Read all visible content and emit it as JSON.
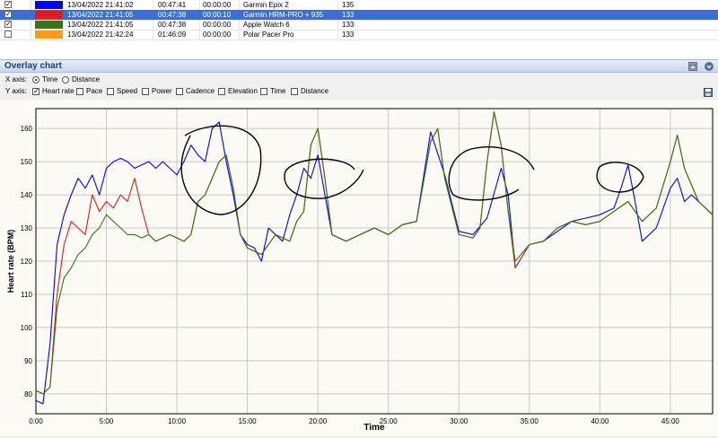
{
  "devices": [
    {
      "checked": true,
      "color": "#0000ff",
      "start": "13/04/2022 21:41:02",
      "duration": "00:47:41",
      "offset": "00:00:00",
      "name": "Garmin Epix 2",
      "value": "135",
      "selected": false
    },
    {
      "checked": true,
      "color": "#d81e1e",
      "start": "13/04/2022 21:41:05",
      "duration": "00:47:38",
      "offset": "00:00:10",
      "name": "Garmin HRM-PRO + 935",
      "value": "133",
      "selected": true
    },
    {
      "checked": true,
      "color": "#2f7b10",
      "start": "13/04/2022 21:41:05",
      "duration": "00:47:38",
      "offset": "00:00:00",
      "name": "Apple Watch 6",
      "value": "133",
      "selected": false
    },
    {
      "checked": false,
      "color": "#ff9a1a",
      "start": "13/04/2022 21:42:24",
      "duration": "01:46:09",
      "offset": "00:00:00",
      "name": "Polar Pacer Pro",
      "value": "133",
      "selected": false
    }
  ],
  "panel": {
    "title": "Overlay chart",
    "x_axis_label": "X axis:",
    "x_options": [
      {
        "label": "Time",
        "selected": true
      },
      {
        "label": "Distance",
        "selected": false
      }
    ],
    "y_axis_label": "Y axis:",
    "y_options": [
      {
        "label": "Heart rate",
        "checked": true
      },
      {
        "label": "Pace",
        "checked": false
      },
      {
        "label": "Speed",
        "checked": false
      },
      {
        "label": "Power",
        "checked": false
      },
      {
        "label": "Cadence",
        "checked": false
      },
      {
        "label": "Elevation",
        "checked": false
      },
      {
        "label": "Time",
        "checked": false
      },
      {
        "label": "Distance",
        "checked": false
      }
    ],
    "icons": [
      "minimize-icon",
      "chevron-down-icon",
      "save-icon"
    ]
  },
  "chart_data": {
    "type": "line",
    "xlabel": "Time",
    "ylabel": "Heart rate (BPM)",
    "x_ticks": [
      "0:00",
      "5:00",
      "10:00",
      "15:00",
      "20:00",
      "25:00",
      "30:00",
      "35:00",
      "40:00",
      "45:00"
    ],
    "y_ticks": [
      80,
      90,
      100,
      110,
      120,
      130,
      140,
      150,
      160
    ],
    "xlim": [
      0,
      48
    ],
    "ylim": [
      74,
      166
    ],
    "grid": true,
    "annotation": "hand-drawn black circles around blue-line peaks",
    "series": [
      {
        "color": "#0000ff",
        "x": [
          0,
          0.5,
          1,
          1.5,
          2,
          2.5,
          3,
          3.5,
          4,
          4.5,
          5,
          5.5,
          6,
          6.5,
          7,
          7.5,
          8,
          8.5,
          9,
          9.5,
          10,
          10.5,
          11,
          11.5,
          12,
          12.5,
          13,
          13.5,
          14,
          14.5,
          15,
          15.5,
          16,
          16.5,
          17,
          17.5,
          18,
          18.5,
          19,
          19.5,
          20,
          20.5,
          21,
          22,
          23,
          24,
          25,
          26,
          27,
          28,
          29,
          30,
          31,
          32,
          33,
          33.5,
          34,
          35,
          36,
          37,
          38,
          39,
          40,
          41,
          41.5,
          42,
          42.5,
          43,
          44,
          45,
          45.5,
          46,
          46.5,
          47,
          48
        ],
        "y": [
          78,
          77,
          95,
          125,
          134,
          140,
          145,
          142,
          146,
          140,
          148,
          150,
          151,
          150,
          148,
          149,
          150,
          148,
          150,
          148,
          146,
          150,
          155,
          152,
          150,
          160,
          162,
          150,
          140,
          128,
          125,
          124,
          120,
          130,
          128,
          126,
          134,
          140,
          148,
          145,
          152,
          140,
          128,
          126,
          128,
          130,
          128,
          131,
          132,
          159,
          146,
          129,
          128,
          133,
          148,
          140,
          118,
          125,
          126,
          129,
          132,
          133,
          134,
          136,
          142,
          149,
          138,
          126,
          130,
          142,
          145,
          138,
          140,
          138,
          134
        ]
      },
      {
        "color": "#d81e1e",
        "x": [
          0,
          0.5,
          1,
          1.5,
          2,
          2.5,
          3,
          3.5,
          4,
          4.5,
          5,
          5.5,
          6,
          6.5,
          7,
          7.5,
          8,
          8.5,
          9,
          9.5,
          10,
          10.5,
          11,
          11.5,
          12,
          12.5,
          13,
          13.5,
          14,
          14.5,
          15,
          16,
          17,
          18,
          18.5,
          19,
          19.5,
          20,
          20.5,
          21,
          22,
          23,
          24,
          25,
          26,
          27,
          28,
          28.5,
          29,
          30,
          31,
          31.5,
          32,
          32.5,
          33,
          33.5,
          34,
          35,
          36,
          37,
          38,
          39,
          40,
          41,
          42,
          43,
          44,
          45,
          45.5,
          46,
          47,
          48
        ],
        "y": [
          81,
          80,
          82,
          110,
          125,
          132,
          130,
          128,
          140,
          135,
          138,
          136,
          140,
          138,
          145,
          136,
          128,
          126,
          127,
          128,
          127,
          126,
          128,
          138,
          140,
          145,
          150,
          152,
          142,
          128,
          124,
          122,
          128,
          126,
          132,
          135,
          155,
          160,
          145,
          128,
          126,
          128,
          130,
          128,
          131,
          132,
          156,
          160,
          145,
          128,
          127,
          130,
          150,
          165,
          155,
          135,
          118,
          125,
          126,
          130,
          132,
          131,
          132,
          135,
          138,
          132,
          136,
          150,
          158,
          148,
          138,
          134
        ]
      },
      {
        "color": "#2f7b10",
        "x": [
          0,
          0.5,
          1,
          1.5,
          2,
          2.5,
          3,
          3.5,
          4,
          4.5,
          5,
          5.5,
          6,
          6.5,
          7,
          7.5,
          8,
          8.5,
          9,
          9.5,
          10,
          10.5,
          11,
          11.5,
          12,
          12.5,
          13,
          13.5,
          14,
          14.5,
          15,
          16,
          17,
          18,
          18.5,
          19,
          19.5,
          20,
          20.5,
          21,
          22,
          23,
          24,
          25,
          26,
          27,
          28,
          28.5,
          29,
          30,
          31,
          31.5,
          32,
          32.5,
          33,
          33.5,
          34,
          35,
          36,
          37,
          38,
          39,
          40,
          41,
          42,
          43,
          44,
          45,
          45.5,
          46,
          47,
          48
        ],
        "y": [
          81,
          80,
          82,
          106,
          115,
          118,
          122,
          124,
          128,
          130,
          134,
          132,
          130,
          128,
          128,
          127,
          128,
          126,
          127,
          128,
          127,
          126,
          128,
          138,
          140,
          145,
          150,
          152,
          142,
          128,
          124,
          122,
          128,
          126,
          132,
          135,
          155,
          160,
          145,
          128,
          126,
          128,
          130,
          128,
          131,
          132,
          156,
          160,
          145,
          128,
          127,
          130,
          150,
          165,
          155,
          135,
          120,
          125,
          126,
          130,
          132,
          131,
          132,
          135,
          138,
          132,
          136,
          150,
          158,
          148,
          138,
          134
        ]
      }
    ]
  }
}
